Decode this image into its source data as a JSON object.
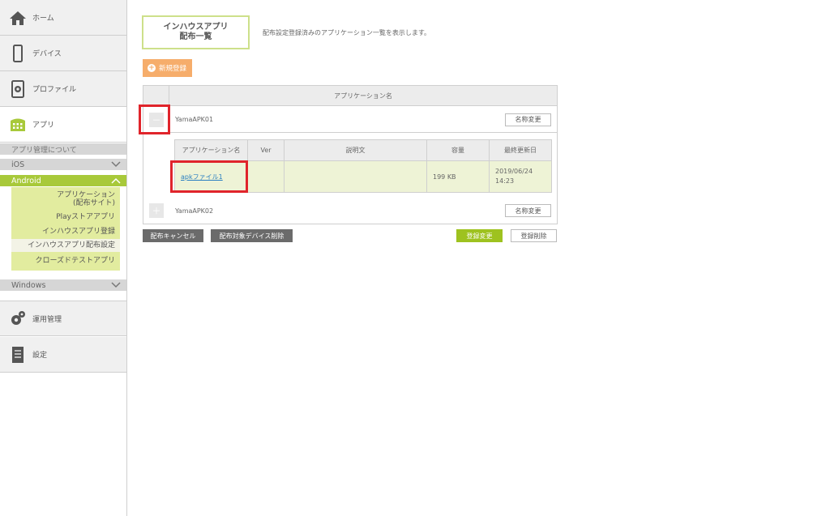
{
  "sidebar": {
    "home": "ホーム",
    "devices": "デバイス",
    "profile": "プロファイル",
    "apps": "アプリ",
    "app_management_header": "アプリ管理について",
    "ios": "iOS",
    "android": "Android",
    "android_items": [
      "アプリケーション\n(配布サイト)",
      "Playストアアプリ",
      "インハウスアプリ登録",
      "インハウスアプリ配布設定",
      "クローズドテストアプリ"
    ],
    "windows": "Windows",
    "operations": "運用管理",
    "settings": "設定"
  },
  "page": {
    "title_line1": "インハウスアプリ",
    "title_line2": "配布一覧",
    "description": "配布設定登録済みのアプリケーション一覧を表示します。",
    "new_button": "新規登録"
  },
  "table": {
    "header": "アプリケーション名",
    "rows": [
      {
        "name": "YamaAPK01",
        "expander": "－",
        "rename": "名称変更"
      },
      {
        "name": "YamaAPK02",
        "expander": "＋",
        "rename": "名称変更"
      }
    ],
    "inner_headers": [
      "アプリケーション名",
      "Ver",
      "説明文",
      "容量",
      "最終更新日"
    ],
    "inner_row": {
      "app": "apkファイル1",
      "ver": "",
      "desc": "",
      "size": "199 KB",
      "updated_date": "2019/06/24",
      "updated_time": "14:23"
    }
  },
  "actions": {
    "cancel_distribution": "配布キャンセル",
    "delete_target_devices": "配布対象デバイス削除",
    "update_registration": "登録変更",
    "delete_registration": "登録削除"
  },
  "colors": {
    "accent_green": "#9ec21f",
    "android_green": "#a8c93a",
    "new_button_orange": "#f6ad6b",
    "highlight_red": "#e0242b"
  }
}
